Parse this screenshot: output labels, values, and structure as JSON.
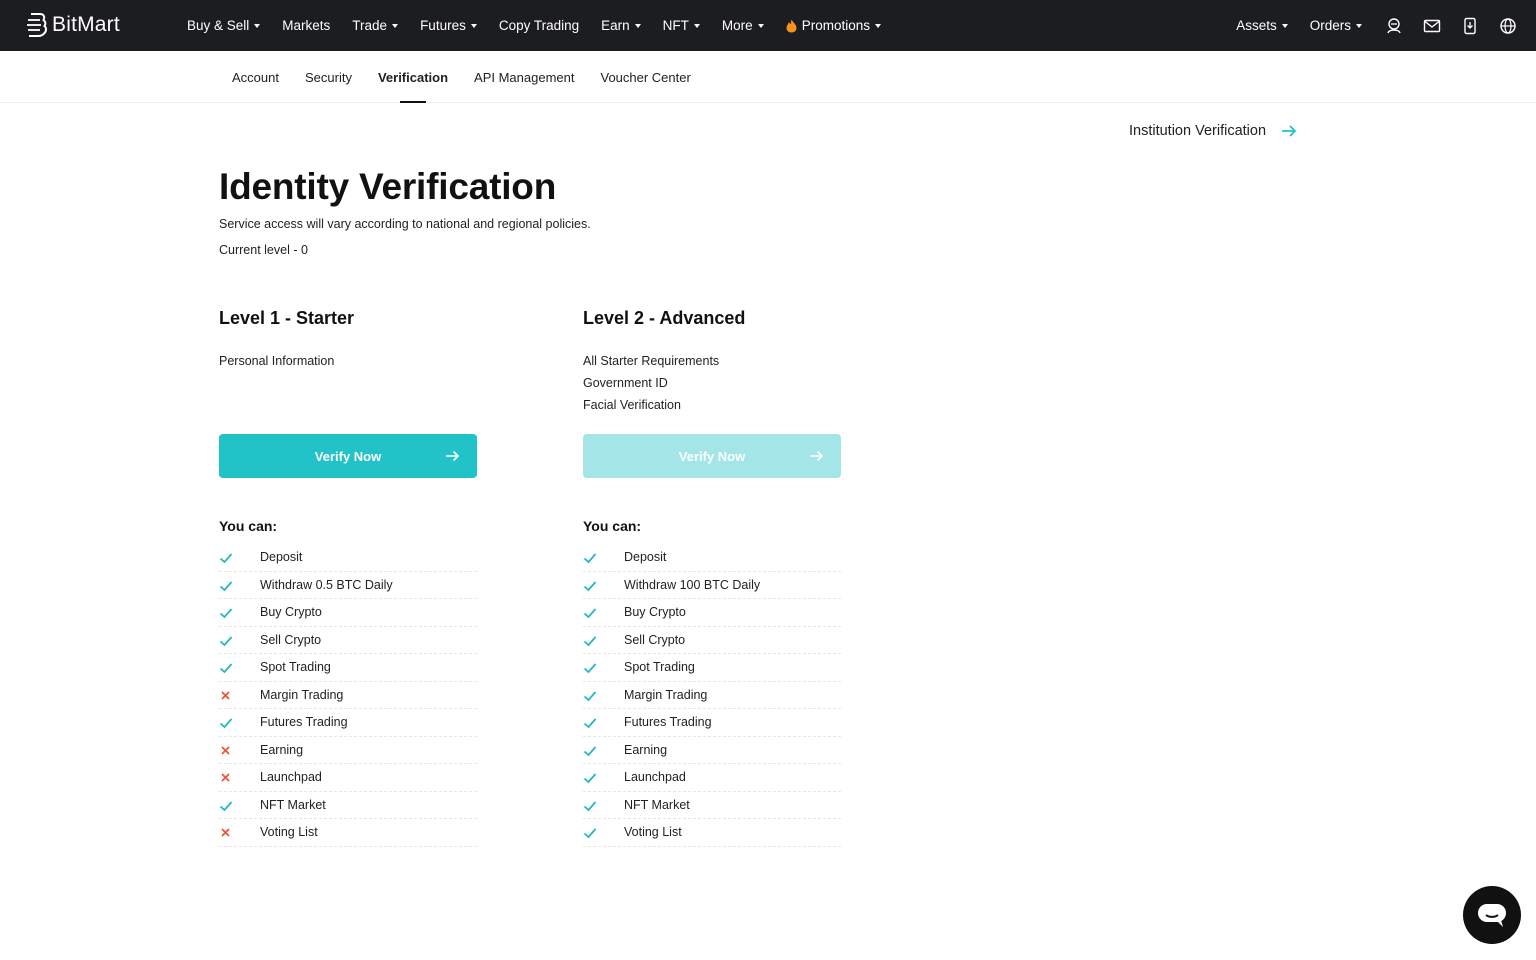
{
  "brand": {
    "name": "BitMart"
  },
  "nav": {
    "items": [
      {
        "label": "Buy & Sell",
        "caret": true
      },
      {
        "label": "Markets",
        "caret": false
      },
      {
        "label": "Trade",
        "caret": true
      },
      {
        "label": "Futures",
        "caret": true
      },
      {
        "label": "Copy Trading",
        "caret": false
      },
      {
        "label": "Earn",
        "caret": true
      },
      {
        "label": "NFT",
        "caret": true
      },
      {
        "label": "More",
        "caret": true
      },
      {
        "label": "Promotions",
        "caret": true
      }
    ],
    "right": [
      {
        "label": "Assets"
      },
      {
        "label": "Orders"
      }
    ],
    "icons": [
      "user-icon",
      "mail-icon",
      "download-icon",
      "globe-icon"
    ]
  },
  "subnav": {
    "items": [
      "Account",
      "Security",
      "Verification",
      "API Management",
      "Voucher Center"
    ],
    "active": "Verification"
  },
  "institution_link": "Institution Verification",
  "page": {
    "title": "Identity Verification",
    "subtitle": "Service access will vary according to national and regional policies.",
    "current_level": "Current level - 0"
  },
  "levels": [
    {
      "title": "Level 1 - Starter",
      "requirements": [
        "Personal Information"
      ],
      "button": "Verify Now",
      "button_state": "enabled",
      "you_can": "You can:",
      "permissions": [
        {
          "label": "Deposit",
          "allowed": true
        },
        {
          "label": "Withdraw 0.5 BTC Daily",
          "allowed": true
        },
        {
          "label": "Buy Crypto",
          "allowed": true
        },
        {
          "label": "Sell Crypto",
          "allowed": true
        },
        {
          "label": "Spot Trading",
          "allowed": true
        },
        {
          "label": "Margin Trading",
          "allowed": false
        },
        {
          "label": "Futures Trading",
          "allowed": true
        },
        {
          "label": "Earning",
          "allowed": false
        },
        {
          "label": "Launchpad",
          "allowed": false
        },
        {
          "label": "NFT Market",
          "allowed": true
        },
        {
          "label": "Voting List",
          "allowed": false
        }
      ]
    },
    {
      "title": "Level 2 - Advanced",
      "requirements": [
        "All Starter Requirements",
        "Government ID",
        "Facial Verification"
      ],
      "button": "Verify Now",
      "button_state": "disabled",
      "you_can": "You can:",
      "permissions": [
        {
          "label": "Deposit",
          "allowed": true
        },
        {
          "label": "Withdraw 100 BTC Daily",
          "allowed": true
        },
        {
          "label": "Buy Crypto",
          "allowed": true
        },
        {
          "label": "Sell Crypto",
          "allowed": true
        },
        {
          "label": "Spot Trading",
          "allowed": true
        },
        {
          "label": "Margin Trading",
          "allowed": true
        },
        {
          "label": "Futures Trading",
          "allowed": true
        },
        {
          "label": "Earning",
          "allowed": true
        },
        {
          "label": "Launchpad",
          "allowed": true
        },
        {
          "label": "NFT Market",
          "allowed": true
        },
        {
          "label": "Voting List",
          "allowed": true
        }
      ]
    }
  ],
  "colors": {
    "topbar": "#1c1d21",
    "accent": "#22c3c8",
    "accent_disabled": "#a4e5e7",
    "check": "#22b8be",
    "cross": "#f0533a"
  }
}
